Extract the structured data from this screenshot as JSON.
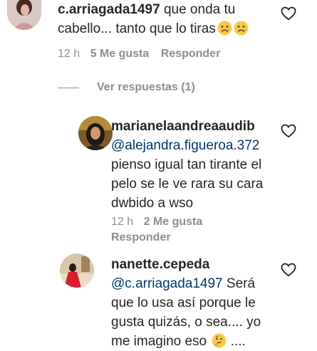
{
  "comments": [
    {
      "username": "c.arriagada1497",
      "text_line1": "que onda tu",
      "text_line2": "cabello... tanto que lo tiras",
      "emojis": [
        "sad-face-emoji",
        "sad-face-emoji"
      ],
      "time": "12 h",
      "likes": "5 Me gusta",
      "reply_label": "Responder",
      "view_replies": "Ver respuestas (1)"
    },
    {
      "username": "marianelaandreaaudib",
      "mention": "@alejandra.figueroa.372",
      "lines": [
        "pienso igual tan tirante el",
        "pelo se le ve rara su cara",
        "dwbido a wso"
      ],
      "time": "12 h",
      "likes": "2 Me gusta",
      "reply_label": "Responder"
    },
    {
      "username": "nanette.cepeda",
      "mention": "@c.arriagada1497",
      "mention_tail": "Será",
      "lines": [
        "que lo usa así porque le",
        "gusta quizás, o sea.... yo"
      ],
      "last_line_start": "me imagino eso",
      "last_line_end": "....",
      "emoji": "thinking-face-emoji"
    }
  ],
  "colors": {
    "text": "#262626",
    "secondary": "#8e8e8e",
    "mention": "#00376b",
    "background": "#ffffff"
  }
}
